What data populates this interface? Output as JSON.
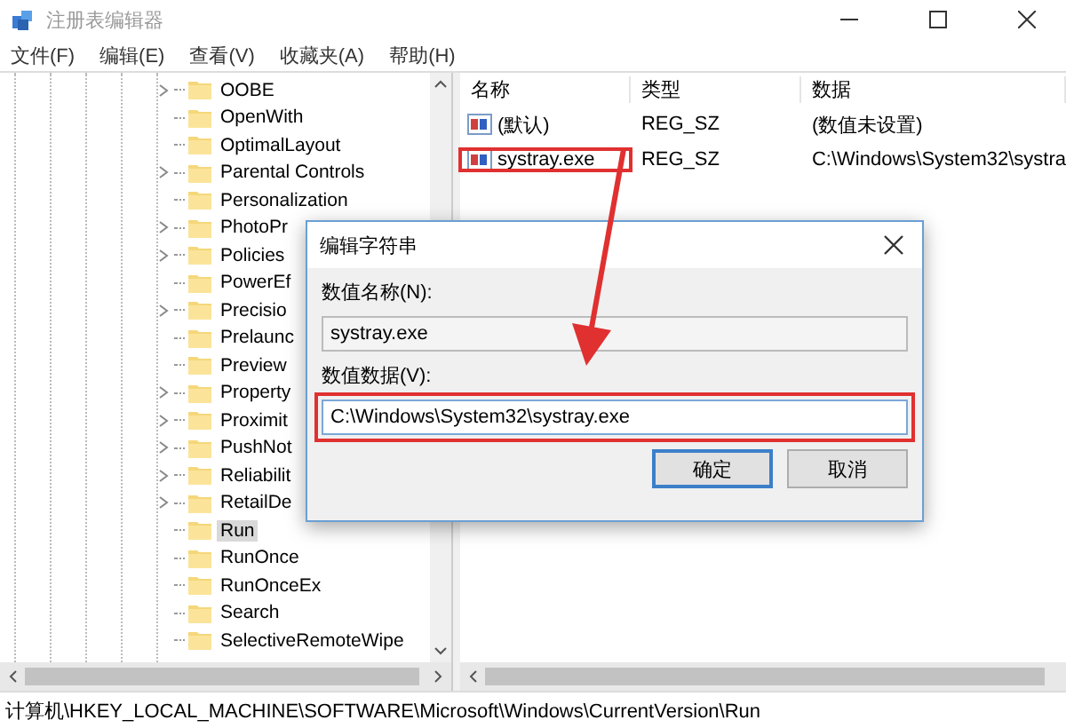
{
  "window": {
    "title": "注册表编辑器"
  },
  "menu": [
    "文件(F)",
    "编辑(E)",
    "查看(V)",
    "收藏夹(A)",
    "帮助(H)"
  ],
  "tree": {
    "items": [
      {
        "label": "OOBE",
        "has_children": true,
        "selected": false
      },
      {
        "label": "OpenWith",
        "has_children": false,
        "selected": false
      },
      {
        "label": "OptimalLayout",
        "has_children": false,
        "selected": false
      },
      {
        "label": "Parental Controls",
        "has_children": true,
        "selected": false
      },
      {
        "label": "Personalization",
        "has_children": false,
        "selected": false
      },
      {
        "label": "PhotoPr",
        "has_children": true,
        "selected": false
      },
      {
        "label": "Policies",
        "has_children": true,
        "selected": false
      },
      {
        "label": "PowerEf",
        "has_children": false,
        "selected": false
      },
      {
        "label": "Precisio",
        "has_children": true,
        "selected": false
      },
      {
        "label": "Prelaunc",
        "has_children": false,
        "selected": false
      },
      {
        "label": "Preview",
        "has_children": false,
        "selected": false
      },
      {
        "label": "Property",
        "has_children": true,
        "selected": false
      },
      {
        "label": "Proximit",
        "has_children": true,
        "selected": false
      },
      {
        "label": "PushNot",
        "has_children": true,
        "selected": false
      },
      {
        "label": "Reliabilit",
        "has_children": true,
        "selected": false
      },
      {
        "label": "RetailDe",
        "has_children": true,
        "selected": false
      },
      {
        "label": "Run",
        "has_children": false,
        "selected": true
      },
      {
        "label": "RunOnce",
        "has_children": false,
        "selected": false
      },
      {
        "label": "RunOnceEx",
        "has_children": false,
        "selected": false
      },
      {
        "label": "Search",
        "has_children": false,
        "selected": false
      },
      {
        "label": "SelectiveRemoteWipe",
        "has_children": false,
        "selected": false
      }
    ]
  },
  "values": {
    "columns": [
      "名称",
      "类型",
      "数据"
    ],
    "rows": [
      {
        "name": "(默认)",
        "type": "REG_SZ",
        "data": "(数值未设置)",
        "highlighted": false
      },
      {
        "name": "systray.exe",
        "type": "REG_SZ",
        "data": "C:\\Windows\\System32\\systra",
        "highlighted": true
      }
    ]
  },
  "dialog": {
    "title": "编辑字符串",
    "name_label": "数值名称(N):",
    "name_value": "systray.exe",
    "data_label": "数值数据(V):",
    "data_value": "C:\\Windows\\System32\\systray.exe",
    "data_highlighted": true,
    "pointer_arrow": true,
    "buttons": [
      {
        "label": "确定",
        "default": true
      },
      {
        "label": "取消",
        "default": false
      }
    ]
  },
  "status_bar": "计算机\\HKEY_LOCAL_MACHINE\\SOFTWARE\\Microsoft\\Windows\\CurrentVersion\\Run"
}
